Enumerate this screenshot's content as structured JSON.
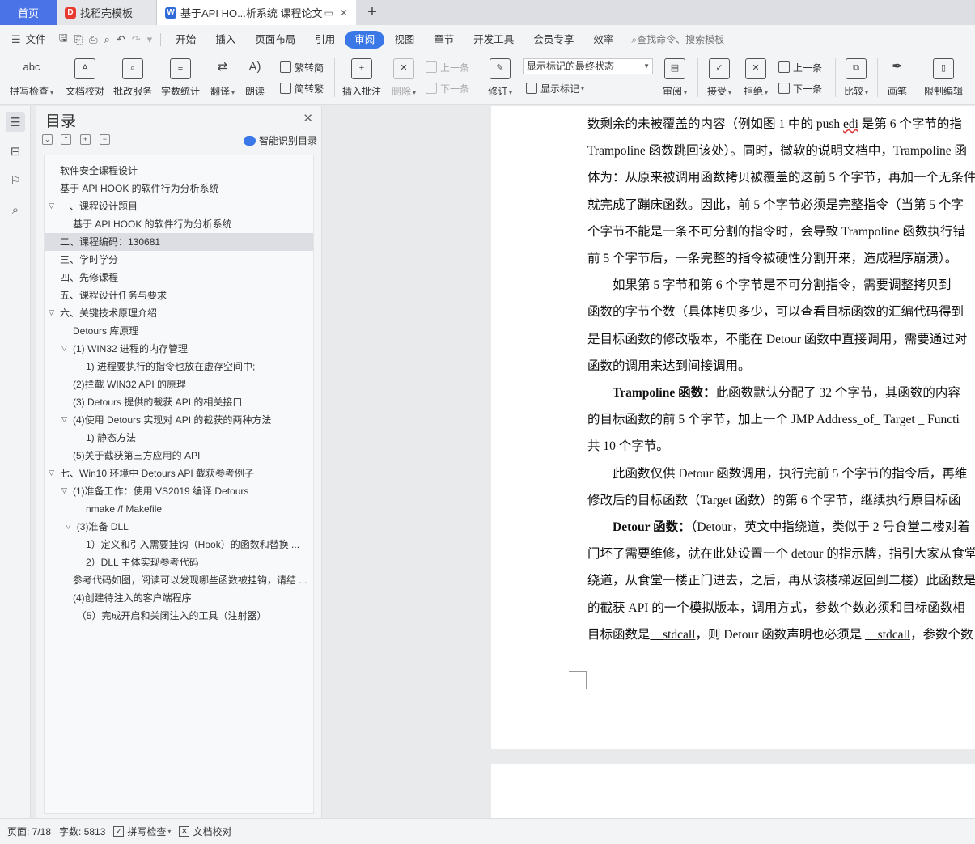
{
  "tabs": [
    {
      "label": "首页"
    },
    {
      "label": "找稻壳模板"
    },
    {
      "label": "基于API HO...析系统 课程论文"
    }
  ],
  "menu": {
    "file": "文件",
    "items": [
      "开始",
      "插入",
      "页面布局",
      "引用",
      "审阅",
      "视图",
      "章节",
      "开发工具",
      "会员专享",
      "效率"
    ],
    "active": "审阅",
    "search": "查找命令、搜索模板"
  },
  "ribbon": {
    "spell_check": "拼写检查",
    "doc_proof": "文档校对",
    "batch_service": "批改服务",
    "word_count": "字数统计",
    "translate": "翻译",
    "read_aloud": "朗读",
    "trad_to_simp": "繁转简",
    "simp_to_trad": "简转繁",
    "insert_comment": "插入批注",
    "delete": "删除",
    "prev_comment": "上一条",
    "next_comment": "下一条",
    "track_changes": "修订",
    "markup_state": "显示标记的最终状态",
    "show_markup": "显示标记",
    "review": "审阅",
    "accept": "接受",
    "reject": "拒绝",
    "prev_change": "上一条",
    "next_change": "下一条",
    "compare": "比较",
    "pen": "画笔",
    "restrict_edit": "限制编辑"
  },
  "toc": {
    "title": "目录",
    "smart": "智能识别目录",
    "items": [
      {
        "text": "软件安全课程设计",
        "indent": 0,
        "arrow": ""
      },
      {
        "text": "基于 API HOOK 的软件行为分析系统",
        "indent": 0,
        "arrow": ""
      },
      {
        "text": "一、课程设计题目",
        "indent": 0,
        "arrow": "v"
      },
      {
        "text": "基于 API HOOK 的软件行为分析系统",
        "indent": 1,
        "arrow": ""
      },
      {
        "text": "二、课程编码：130681",
        "indent": 0,
        "arrow": "",
        "selected": true
      },
      {
        "text": "三、学时学分",
        "indent": 0,
        "arrow": ""
      },
      {
        "text": "四、先修课程",
        "indent": 0,
        "arrow": ""
      },
      {
        "text": "五、课程设计任务与要求",
        "indent": 0,
        "arrow": ""
      },
      {
        "text": "六、关键技术原理介绍",
        "indent": 0,
        "arrow": "v"
      },
      {
        "text": "Detours 库原理",
        "indent": 1,
        "arrow": ""
      },
      {
        "text": "(1) WIN32 进程的内存管理",
        "indent": 1,
        "arrow": "v"
      },
      {
        "text": "1) 进程要执行的指令也放在虚存空间中;",
        "indent": 2,
        "arrow": ""
      },
      {
        "text": "(2)拦截 WIN32 API 的原理",
        "indent": 1,
        "arrow": ""
      },
      {
        "text": "(3) Detours 提供的截获 API 的相关接口",
        "indent": 1,
        "arrow": ""
      },
      {
        "text": "(4)使用 Detours 实现对 API 的截获的两种方法",
        "indent": 1,
        "arrow": "v"
      },
      {
        "text": "1)  静态方法",
        "indent": 2,
        "arrow": ""
      },
      {
        "text": "(5)关于截获第三方应用的 API",
        "indent": 1,
        "arrow": ""
      },
      {
        "text": "七、Win10 环境中 Detours API 截获参考例子",
        "indent": 0,
        "arrow": "v"
      },
      {
        "text": "(1)准备工作：使用 VS2019 编译 Detours",
        "indent": 1,
        "arrow": "v"
      },
      {
        "text": "nmake /f Makefile",
        "indent": 2,
        "arrow": ""
      },
      {
        "text": "(3)准备 DLL",
        "indent": 1.3,
        "arrow": "v"
      },
      {
        "text": "1）定义和引入需要挂钩（Hook）的函数和替换 ...",
        "indent": 2,
        "arrow": ""
      },
      {
        "text": "2）DLL 主体实现参考代码",
        "indent": 2,
        "arrow": ""
      },
      {
        "text": "参考代码如图，阅读可以发现哪些函数被挂钩，请结 ...",
        "indent": 1,
        "arrow": ""
      },
      {
        "text": "(4)创建待注入的客户端程序",
        "indent": 1,
        "arrow": ""
      },
      {
        "text": "（5）完成开启和关闭注入的工具（注射器）",
        "indent": 1.3,
        "arrow": ""
      }
    ]
  },
  "document": {
    "lines": [
      {
        "pre": "数剩余的未被覆盖的内容（例如图 1 中的 push ",
        "wavy": "edi",
        "post": " 是第 6 个字节的指"
      },
      {
        "pre": "Trampoline 函数跳回该处）。同时，微软的说明文档中，Trampoline 函"
      },
      {
        "pre": "体为：从原来被调用函数拷贝被覆盖的这前 5 个字节，再加一个无条件"
      },
      {
        "pre": "就完成了蹦床函数。因此，前 5 个字节必须是完整指令（当第 5 个字"
      },
      {
        "pre": "个字节不能是一条不可分割的指令时，会导致 Trampoline 函数执行错"
      },
      {
        "pre": "前 5 个字节后，一条完整的指令被硬性分割开来，造成程序崩溃）。"
      },
      {
        "pre": "　　如果第 5 字节和第 6 个字节是不可分割指令，需要调整拷贝到"
      },
      {
        "pre": "函数的字节个数（具体拷贝多少，可以查看目标函数的汇编代码得到"
      },
      {
        "pre": "是目标函数的修改版本，不能在 Detour 函数中直接调用，需要通过对"
      },
      {
        "pre": "函数的调用来达到间接调用。"
      },
      {
        "bold": "　　Trampoline 函数：",
        "post": "此函数默认分配了 32 个字节，其函数的内容"
      },
      {
        "pre": "的目标函数的前 5 个字节，加上一个 JMP Address_of_ Target _ Functi"
      },
      {
        "pre": "共 10 个字节。"
      },
      {
        "pre": "　　此函数仅供 Detour 函数调用，执行完前 5 个字节的指令后，再维"
      },
      {
        "pre": "修改后的目标函数（Target 函数）的第 6 个字节，继续执行原目标函"
      },
      {
        "bold": "　　Detour 函数：",
        "post": "（Detour，英文中指绕道，类似于 2 号食堂二楼对着"
      },
      {
        "pre": "门坏了需要维修，就在此处设置一个 detour 的指示牌，指引大家从食堂"
      },
      {
        "pre": "绕道，从食堂一楼正门进去，之后，再从该楼梯返回到二楼）此函数是"
      },
      {
        "pre": "的截获 API 的一个模拟版本，调用方式，参数个数必须和目标函数相"
      },
      {
        "pre": "目标函数是",
        "uline": "__stdcall",
        "post": "，则 Detour 函数声明也必须是  ",
        "uline2": "__stdcall",
        "post2": "，参数个数"
      }
    ]
  },
  "status": {
    "page": "页面: 7/18",
    "words": "字数: 5813",
    "spell": "拼写检查",
    "proof": "文档校对"
  }
}
